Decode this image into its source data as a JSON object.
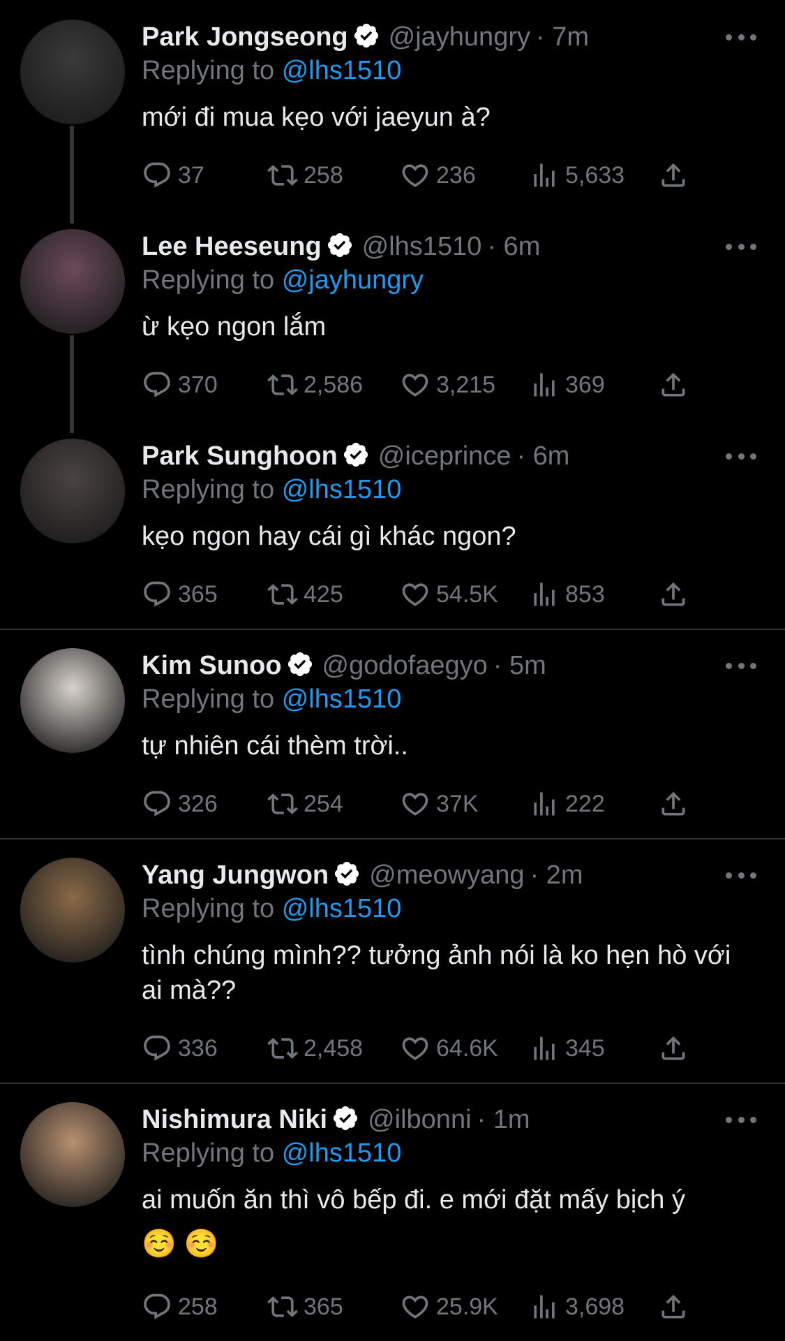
{
  "tweets": [
    {
      "name": "Park Jongseong",
      "handle": "@jayhungry",
      "time": "· 7m",
      "replying_prefix": "Replying to",
      "replying_to": "@lhs1510",
      "text": "mới đi mua kẹo với jaeyun à?",
      "replies": "37",
      "retweets": "258",
      "likes": "236",
      "views": "5,633",
      "avatar_color": "#3a3a3a"
    },
    {
      "name": "Lee Heeseung",
      "handle": "@lhs1510",
      "time": "· 6m",
      "replying_prefix": "Replying to",
      "replying_to": "@jayhungry",
      "text": "ừ kẹo ngon lắm",
      "replies": "370",
      "retweets": "2,586",
      "likes": "3,215",
      "views": "369",
      "avatar_color": "#6b4a5a"
    },
    {
      "name": "Park Sunghoon",
      "handle": "@iceprince",
      "time": "· 6m",
      "replying_prefix": "Replying to",
      "replying_to": "@lhs1510",
      "text": "kẹo ngon hay cái gì khác ngon?",
      "replies": "365",
      "retweets": "425",
      "likes": "54.5K",
      "views": "853",
      "avatar_color": "#4a4442"
    },
    {
      "name": "Kim Sunoo",
      "handle": "@godofaegyo",
      "time": "· 5m",
      "replying_prefix": "Replying to",
      "replying_to": "@lhs1510",
      "text": "tự nhiên cái thèm trời..",
      "replies": "326",
      "retweets": "254",
      "likes": "37K",
      "views": "222",
      "avatar_color": "#d8d2cc"
    },
    {
      "name": "Yang Jungwon",
      "handle": "@meowyang",
      "time": "· 2m",
      "replying_prefix": "Replying to",
      "replying_to": "@lhs1510",
      "text": "tình chúng mình?? tưởng ảnh nói là ko hẹn hò với ai mà??",
      "replies": "336",
      "retweets": "2,458",
      "likes": "64.6K",
      "views": "345",
      "avatar_color": "#8a6a48"
    },
    {
      "name": "Nishimura Niki",
      "handle": "@ilbonni",
      "time": "· 1m",
      "replying_prefix": "Replying to",
      "replying_to": "@lhs1510",
      "text": "ai muốn ăn thì vô bếp đi. e mới đặt mấy bịch ý",
      "emoji": "☺️ ☺️",
      "replies": "258",
      "retweets": "365",
      "likes": "25.9K",
      "views": "3,698",
      "avatar_color": "#b89070"
    }
  ],
  "colors": {
    "background": "#000000",
    "text": "#e7e9ea",
    "secondary": "#71767b",
    "link": "#1d9bf0",
    "verified": "#ffffff"
  },
  "icons": [
    "reply-icon",
    "retweet-icon",
    "like-icon",
    "views-icon",
    "share-icon",
    "verified-badge-icon",
    "more-icon"
  ]
}
